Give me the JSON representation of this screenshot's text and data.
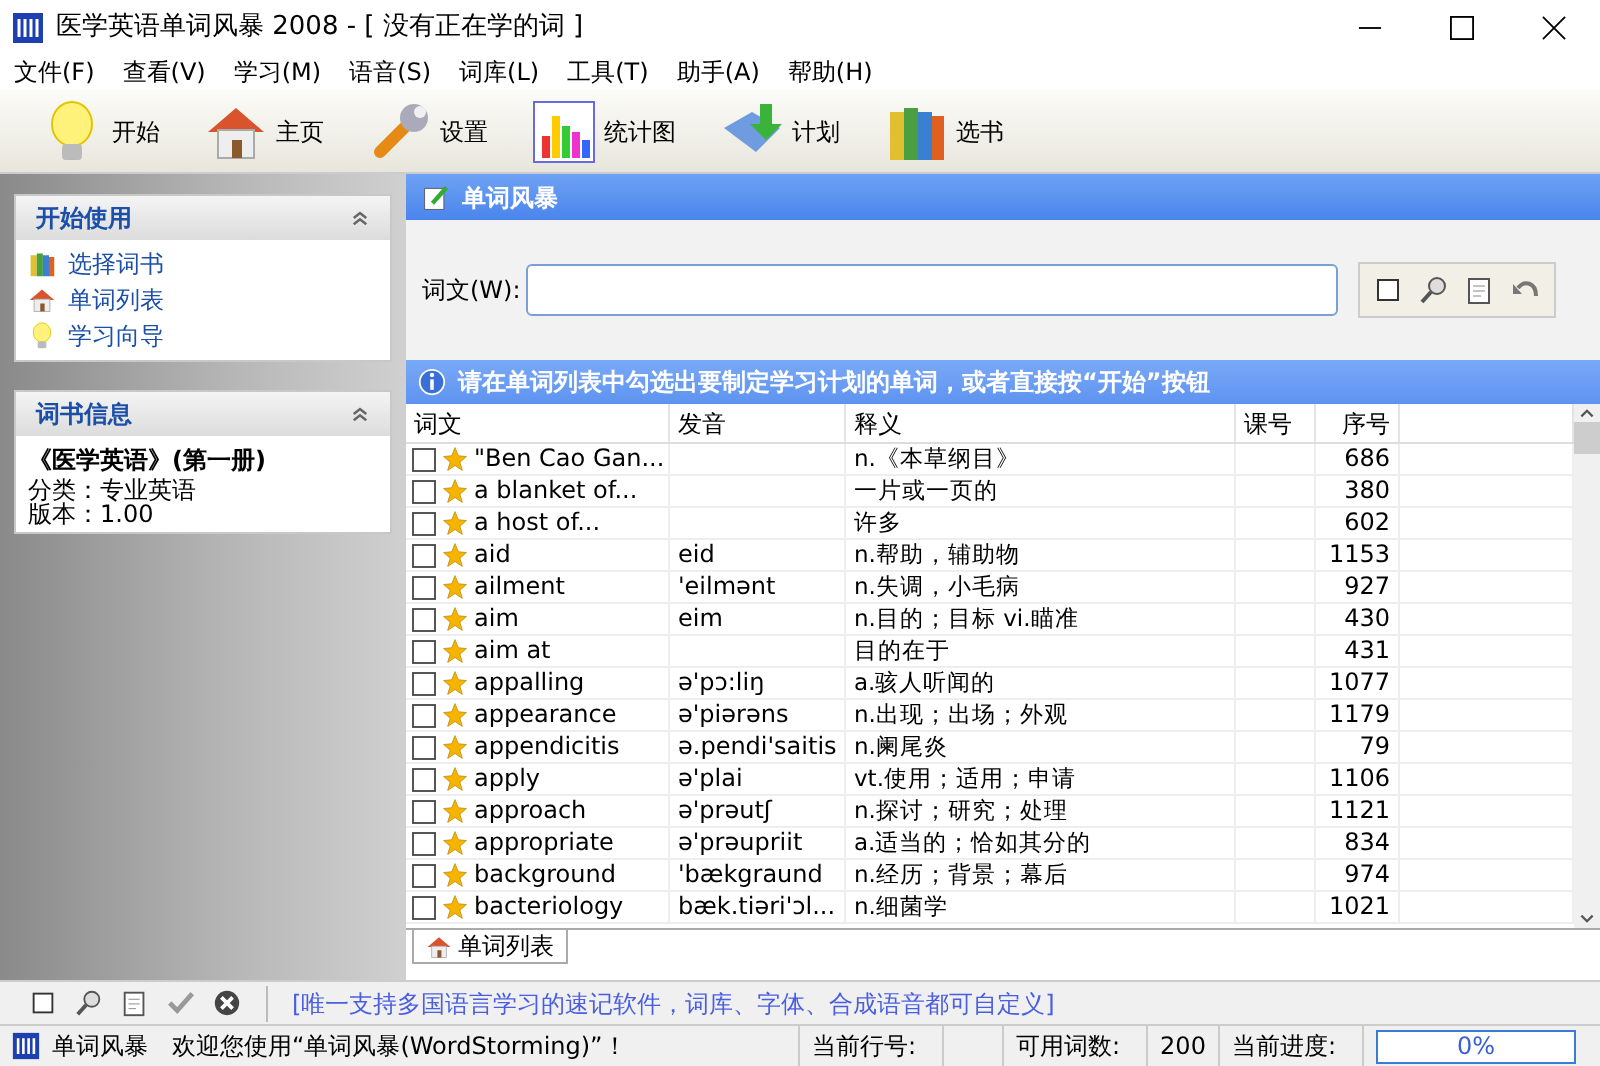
{
  "window": {
    "title": "医学英语单词风暴 2008 - [ 没有正在学的词 ]"
  },
  "menu": [
    "文件(F)",
    "查看(V)",
    "学习(M)",
    "语音(S)",
    "词库(L)",
    "工具(T)",
    "助手(A)",
    "帮助(H)"
  ],
  "toolbar": [
    {
      "label": "开始",
      "kind": "bulb"
    },
    {
      "label": "主页",
      "kind": "house"
    },
    {
      "label": "设置",
      "kind": "wrench"
    },
    {
      "label": "统计图",
      "kind": "chart"
    },
    {
      "label": "计划",
      "kind": "plan"
    },
    {
      "label": "选书",
      "kind": "books"
    }
  ],
  "sidebar": {
    "panels": [
      {
        "title": "开始使用",
        "items": [
          {
            "label": "选择词书",
            "kind": "books"
          },
          {
            "label": "单词列表",
            "kind": "house"
          },
          {
            "label": "学习向导",
            "kind": "bulb"
          }
        ]
      },
      {
        "title": "词书信息",
        "book": "《医学英语》(第一册)",
        "lines": [
          "分类：专业英语",
          "版本：1.00"
        ]
      }
    ]
  },
  "panel": {
    "title": "单词风暴",
    "search_label": "词文(W):",
    "info": "请在单词列表中勾选出要制定学习计划的单词，或者直接按“开始”按钮"
  },
  "table": {
    "columns": [
      "词文",
      "发音",
      "释义",
      "课号",
      "序号"
    ],
    "rows": [
      {
        "checked": false,
        "word": "\"Ben Cao Gan...",
        "phonetic": "",
        "meaning": "n.《本草纲目》",
        "lesson": "",
        "number": "686"
      },
      {
        "checked": false,
        "word": "a blanket of...",
        "phonetic": "",
        "meaning": "一片或一页的",
        "lesson": "",
        "number": "380"
      },
      {
        "checked": false,
        "word": "a host of...",
        "phonetic": "",
        "meaning": "许多",
        "lesson": "",
        "number": "602"
      },
      {
        "checked": false,
        "word": "aid",
        "phonetic": "eid",
        "meaning": "n.帮助，辅助物",
        "lesson": "",
        "number": "1153"
      },
      {
        "checked": false,
        "word": "ailment",
        "phonetic": "'eilmənt",
        "meaning": "n.失调，小毛病",
        "lesson": "",
        "number": "927"
      },
      {
        "checked": false,
        "word": "aim",
        "phonetic": "eim",
        "meaning": "n.目的；目标 vi.瞄准",
        "lesson": "",
        "number": "430"
      },
      {
        "checked": false,
        "word": "aim at",
        "phonetic": "",
        "meaning": "目的在于",
        "lesson": "",
        "number": "431"
      },
      {
        "checked": false,
        "word": "appalling",
        "phonetic": "ə'pɔ:liŋ",
        "meaning": "a.骇人听闻的",
        "lesson": "",
        "number": "1077"
      },
      {
        "checked": false,
        "word": "appearance",
        "phonetic": "ə'piərəns",
        "meaning": "n.出现；出场；外观",
        "lesson": "",
        "number": "1179"
      },
      {
        "checked": false,
        "word": "appendicitis",
        "phonetic": "ə.pendi'saitis",
        "meaning": "n.阑尾炎",
        "lesson": "",
        "number": "79"
      },
      {
        "checked": false,
        "word": "apply",
        "phonetic": "ə'plai",
        "meaning": "vt.使用；适用；申请",
        "lesson": "",
        "number": "1106"
      },
      {
        "checked": false,
        "word": "approach",
        "phonetic": "ə'prəutʃ",
        "meaning": "n.探讨；研究；处理",
        "lesson": "",
        "number": "1121"
      },
      {
        "checked": false,
        "word": "appropriate",
        "phonetic": "ə'prəupriit",
        "meaning": "a.适当的；恰如其分的",
        "lesson": "",
        "number": "834"
      },
      {
        "checked": false,
        "word": "background",
        "phonetic": "'bækgraund",
        "meaning": "n.经历；背景；幕后",
        "lesson": "",
        "number": "974"
      },
      {
        "checked": false,
        "word": "bacteriology",
        "phonetic": "bæk.tiəri'ɔl...",
        "meaning": "n.细菌学",
        "lesson": "",
        "number": "1021"
      }
    ]
  },
  "bottom_tab": {
    "label": "单词列表",
    "selected": true
  },
  "footer_text": "[唯一支持多国语言学习的速记软件，词库、字体、合成语音都可自定义]",
  "status_bar": {
    "app": "单词风暴",
    "welcome": "欢迎您使用“单词风暴(WordStorming)”！",
    "row_label": "当前行号:",
    "count_label": "可用词数:",
    "count": "200",
    "progress_label": "当前进度:",
    "progress": "0%",
    "level": 0
  }
}
